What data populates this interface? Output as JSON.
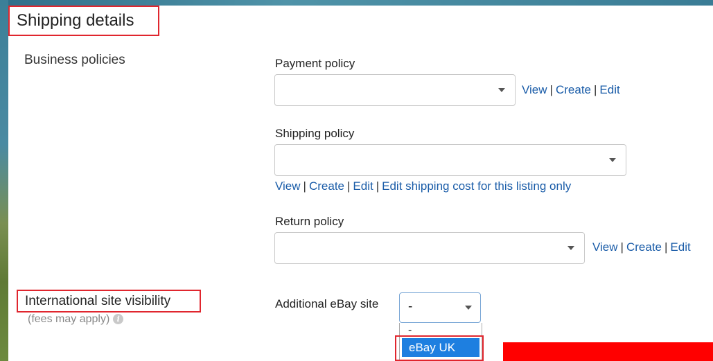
{
  "section": {
    "title": "Shipping details",
    "business_policies_label": "Business policies"
  },
  "payment_policy": {
    "label": "Payment policy",
    "value": "",
    "links": {
      "view": "View",
      "create": "Create",
      "edit": "Edit",
      "separator": "|"
    }
  },
  "shipping_policy": {
    "label": "Shipping policy",
    "value": "",
    "links": {
      "view": "View",
      "create": "Create",
      "edit": "Edit",
      "edit_cost": "Edit shipping cost for this listing only",
      "separator": "|"
    }
  },
  "return_policy": {
    "label": "Return policy",
    "value": "",
    "links": {
      "view": "View",
      "create": "Create",
      "edit": "Edit",
      "separator": "|"
    }
  },
  "international": {
    "label": "International site visibility",
    "fees_note": "(fees may apply)",
    "info_icon_glyph": "i",
    "additional_site_label": "Additional eBay site",
    "selected_value": "-",
    "options": [
      "-",
      "eBay UK"
    ],
    "highlighted_option": "eBay UK"
  },
  "colors": {
    "annotation_red": "#e0262e",
    "link_blue": "#1a5ca8",
    "option_highlight_blue": "#1e7fe0"
  }
}
